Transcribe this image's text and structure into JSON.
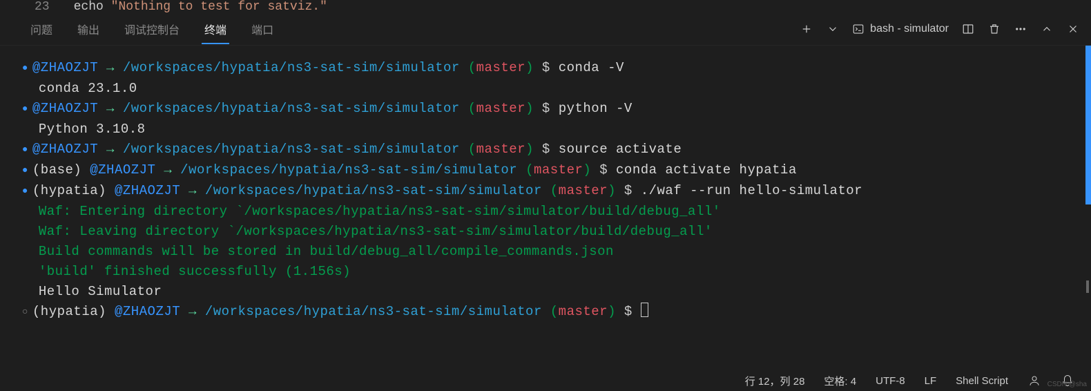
{
  "editor_strip": {
    "line_no": "23",
    "keyword": "echo",
    "string": "\"Nothing to test for satviz.\""
  },
  "panel": {
    "tabs": [
      "问题",
      "输出",
      "调试控制台",
      "终端",
      "端口"
    ],
    "active_index": 3,
    "shell_label": "bash - simulator"
  },
  "prompt": {
    "user": "@ZHAOZJT",
    "arrow": "→",
    "path": "/workspaces/hypatia/ns3-sat-sim/simulator",
    "branch": "master",
    "symbol": "$",
    "env_base": "(base)",
    "env_hypatia": "(hypatia)"
  },
  "session": {
    "cmd1": "conda -V",
    "out1": "conda 23.1.0",
    "cmd2": "python -V",
    "out2": "Python 3.10.8",
    "cmd3": "source activate",
    "cmd4": "conda activate hypatia",
    "cmd5": "./waf --run hello-simulator",
    "waf_enter": "Waf: Entering directory `/workspaces/hypatia/ns3-sat-sim/simulator/build/debug_all'",
    "waf_leave": "Waf: Leaving directory `/workspaces/hypatia/ns3-sat-sim/simulator/build/debug_all'",
    "waf_store": "Build commands will be stored in build/debug_all/compile_commands.json",
    "waf_done": "'build' finished successfully (1.156s)",
    "hello": "Hello Simulator"
  },
  "status": {
    "position": "行 12，列 28",
    "indent": "空格: 4",
    "encoding": "UTF-8",
    "eol": "LF",
    "lang": "Shell Script"
  },
  "watermark": "CSDN @sha"
}
